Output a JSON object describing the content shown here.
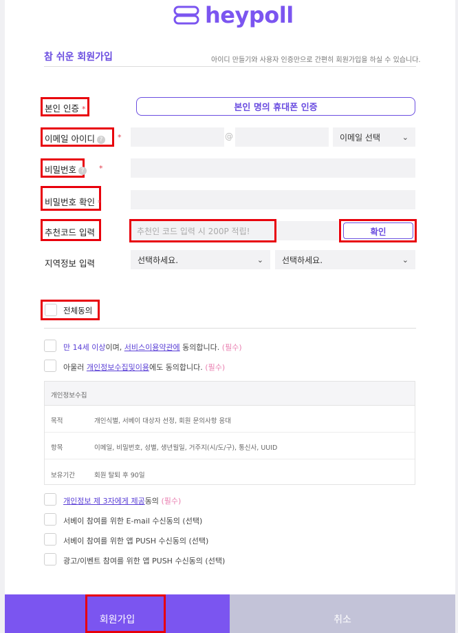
{
  "brand": {
    "name": "heypoll",
    "color": "#7b55f0"
  },
  "header": {
    "title": "참 쉬운 회원가입",
    "subtitle": "아이디 만들기와 사용자 인증만으로 간편히 회원가입을 하실 수 있습니다."
  },
  "form": {
    "identity": {
      "label": "본인 인증",
      "button": "본인 명의 휴대폰 인증"
    },
    "email": {
      "label": "이메일 아이디",
      "help": "?",
      "at": "@",
      "domain_select": "이메일 선택"
    },
    "password": {
      "label": "비밀번호"
    },
    "password_confirm": {
      "label": "비밀번호 확인"
    },
    "referral": {
      "label": "추천코드 입력",
      "placeholder": "추천인 코드 입력 시 200P 적립!",
      "button": "확인"
    },
    "region": {
      "label": "지역정보 입력",
      "select1": "선택하세요.",
      "select2": "선택하세요."
    },
    "required_mark": "*"
  },
  "agreements": {
    "all": "전체동의",
    "items": [
      {
        "pre": "만 14세 이상",
        "mid": "이며, ",
        "link": "서비스이용약관에",
        "post": " 동의합니다. ",
        "tag": "(필수)"
      },
      {
        "pre": "아울러 ",
        "link": "개인정보수집및이용",
        "post": "에도 동의합니다. ",
        "tag": "(필수)"
      },
      {
        "link": "개인정보 제 3자에게 제공",
        "post": "동의 ",
        "tag": "(필수)"
      },
      {
        "text": "서베이 참여를 위한 E-mail 수신동의 (선택)"
      },
      {
        "text": "서베이 참여를 위한 앱 PUSH 수신동의 (선택)"
      },
      {
        "text": "광고/이벤트 참여를 위한 앱 PUSH 수신동의 (선택)"
      }
    ]
  },
  "privacy_table": {
    "heading": "개인정보수집",
    "rows": [
      {
        "key": "목적",
        "value": "개인식별, 서베이 대상자 선정, 회원 문의사항 응대"
      },
      {
        "key": "항목",
        "value": "이메일, 비밀번호, 성별, 생년월일, 거주지(시/도/구), 통신사, UUID"
      },
      {
        "key": "보유기간",
        "value": "회원 탈퇴 후 90일"
      }
    ]
  },
  "actions": {
    "submit": "회원가입",
    "cancel": "취소"
  }
}
